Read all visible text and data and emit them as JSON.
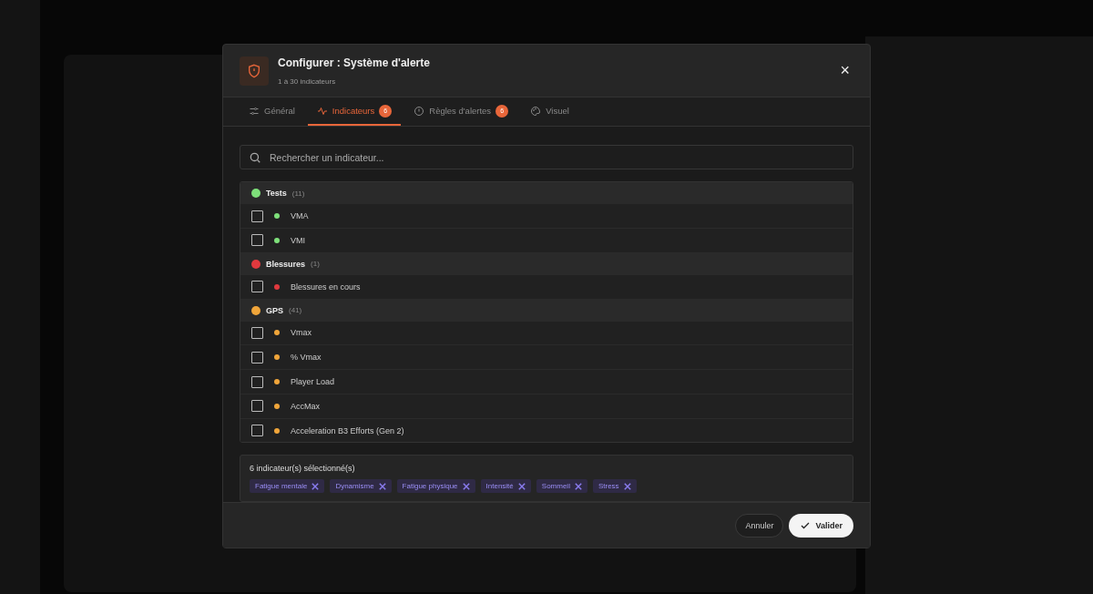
{
  "dialog": {
    "title": "Configurer : Système d'alerte",
    "subtitle": "1 à 30 indicateurs",
    "close": "×"
  },
  "tabs": [
    {
      "label": "Général",
      "selected": false
    },
    {
      "label": "Indicateurs",
      "badge": "6",
      "selected": true
    },
    {
      "label": "Règles d'alertes",
      "badge": "6",
      "selected": false
    },
    {
      "label": "Visuel",
      "selected": false
    }
  ],
  "search": {
    "placeholder": "Rechercher un indicateur..."
  },
  "groups": [
    {
      "name": "Tests",
      "count": "(11)",
      "color": "#7ee07a",
      "items": [
        {
          "label": "VMA",
          "checked": false
        },
        {
          "label": "VMI",
          "checked": false
        }
      ]
    },
    {
      "name": "Blessures",
      "count": "(1)",
      "color": "#e0393e",
      "items": [
        {
          "label": "Blessures en cours",
          "checked": false
        }
      ]
    },
    {
      "name": "GPS",
      "count": "(41)",
      "color": "#f0a53a",
      "items": [
        {
          "label": "Vmax",
          "checked": false
        },
        {
          "label": "% Vmax",
          "checked": false
        },
        {
          "label": "Player Load",
          "checked": false
        },
        {
          "label": "AccMax",
          "checked": false
        },
        {
          "label": "Acceleration B3 Efforts (Gen 2)",
          "checked": false
        }
      ]
    }
  ],
  "selection": {
    "summary": "6 indicateur(s) sélectionné(s)",
    "tags": [
      "Fatigue mentale",
      "Dynamisme",
      "Fatigue physique",
      "Intensité",
      "Sommeil",
      "Stress"
    ]
  },
  "buttons": {
    "cancel": "Annuler",
    "confirm": "Valider"
  }
}
